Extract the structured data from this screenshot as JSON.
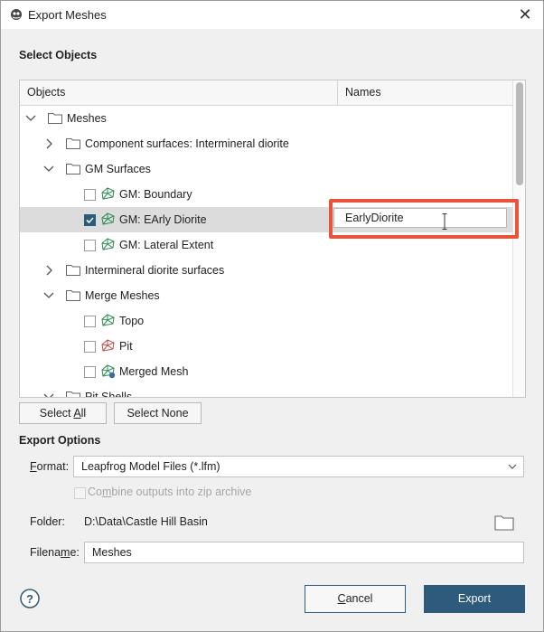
{
  "window": {
    "title": "Export Meshes",
    "close_glyph": "✕",
    "icon": "leapfrog-app-icon"
  },
  "select_objects": {
    "heading": "Select Objects",
    "columns": {
      "objects": "Objects",
      "names": "Names"
    },
    "tree": [
      {
        "label": "Meshes",
        "expanded": true
      },
      {
        "label": "Component surfaces: Intermineral diorite",
        "expanded": false
      },
      {
        "label": "GM Surfaces",
        "expanded": true
      },
      {
        "label": "GM: Boundary",
        "checked": false
      },
      {
        "label": "GM: EArly Diorite",
        "checked": true
      },
      {
        "label": "GM: Lateral Extent",
        "checked": false
      },
      {
        "label": "Intermineral diorite surfaces",
        "expanded": false
      },
      {
        "label": "Merge Meshes",
        "expanded": true
      },
      {
        "label": "Topo",
        "checked": false
      },
      {
        "label": "Pit",
        "checked": false
      },
      {
        "label": "Merged Mesh",
        "checked": false
      },
      {
        "label": "Pit Shells",
        "expanded": true
      }
    ],
    "name_edit_value": "EarlyDiorite",
    "highlight_color": "#e8543a"
  },
  "buttons": {
    "select_all_pre": "Select ",
    "select_all_u": "A",
    "select_all_post": "ll",
    "select_none": "Select None"
  },
  "export_options": {
    "heading": "Export Options",
    "format_label_u": "F",
    "format_label_rest": "ormat:",
    "format_value": "Leapfrog Model Files (*.lfm)",
    "zip_label_pre": "Co",
    "zip_label_u": "m",
    "zip_label_post": "bine outputs into zip archive",
    "zip_checked": false,
    "folder_label": "Folder:",
    "folder_value": "D:\\Data\\Castle Hill Basin",
    "filename_label_pre": "Filena",
    "filename_label_u": "m",
    "filename_label_post": "e:",
    "filename_value": "Meshes"
  },
  "footer": {
    "help_glyph": "?",
    "cancel_u": "C",
    "cancel_rest": "ancel",
    "export": "Export",
    "accent": "#2e5b7b"
  }
}
